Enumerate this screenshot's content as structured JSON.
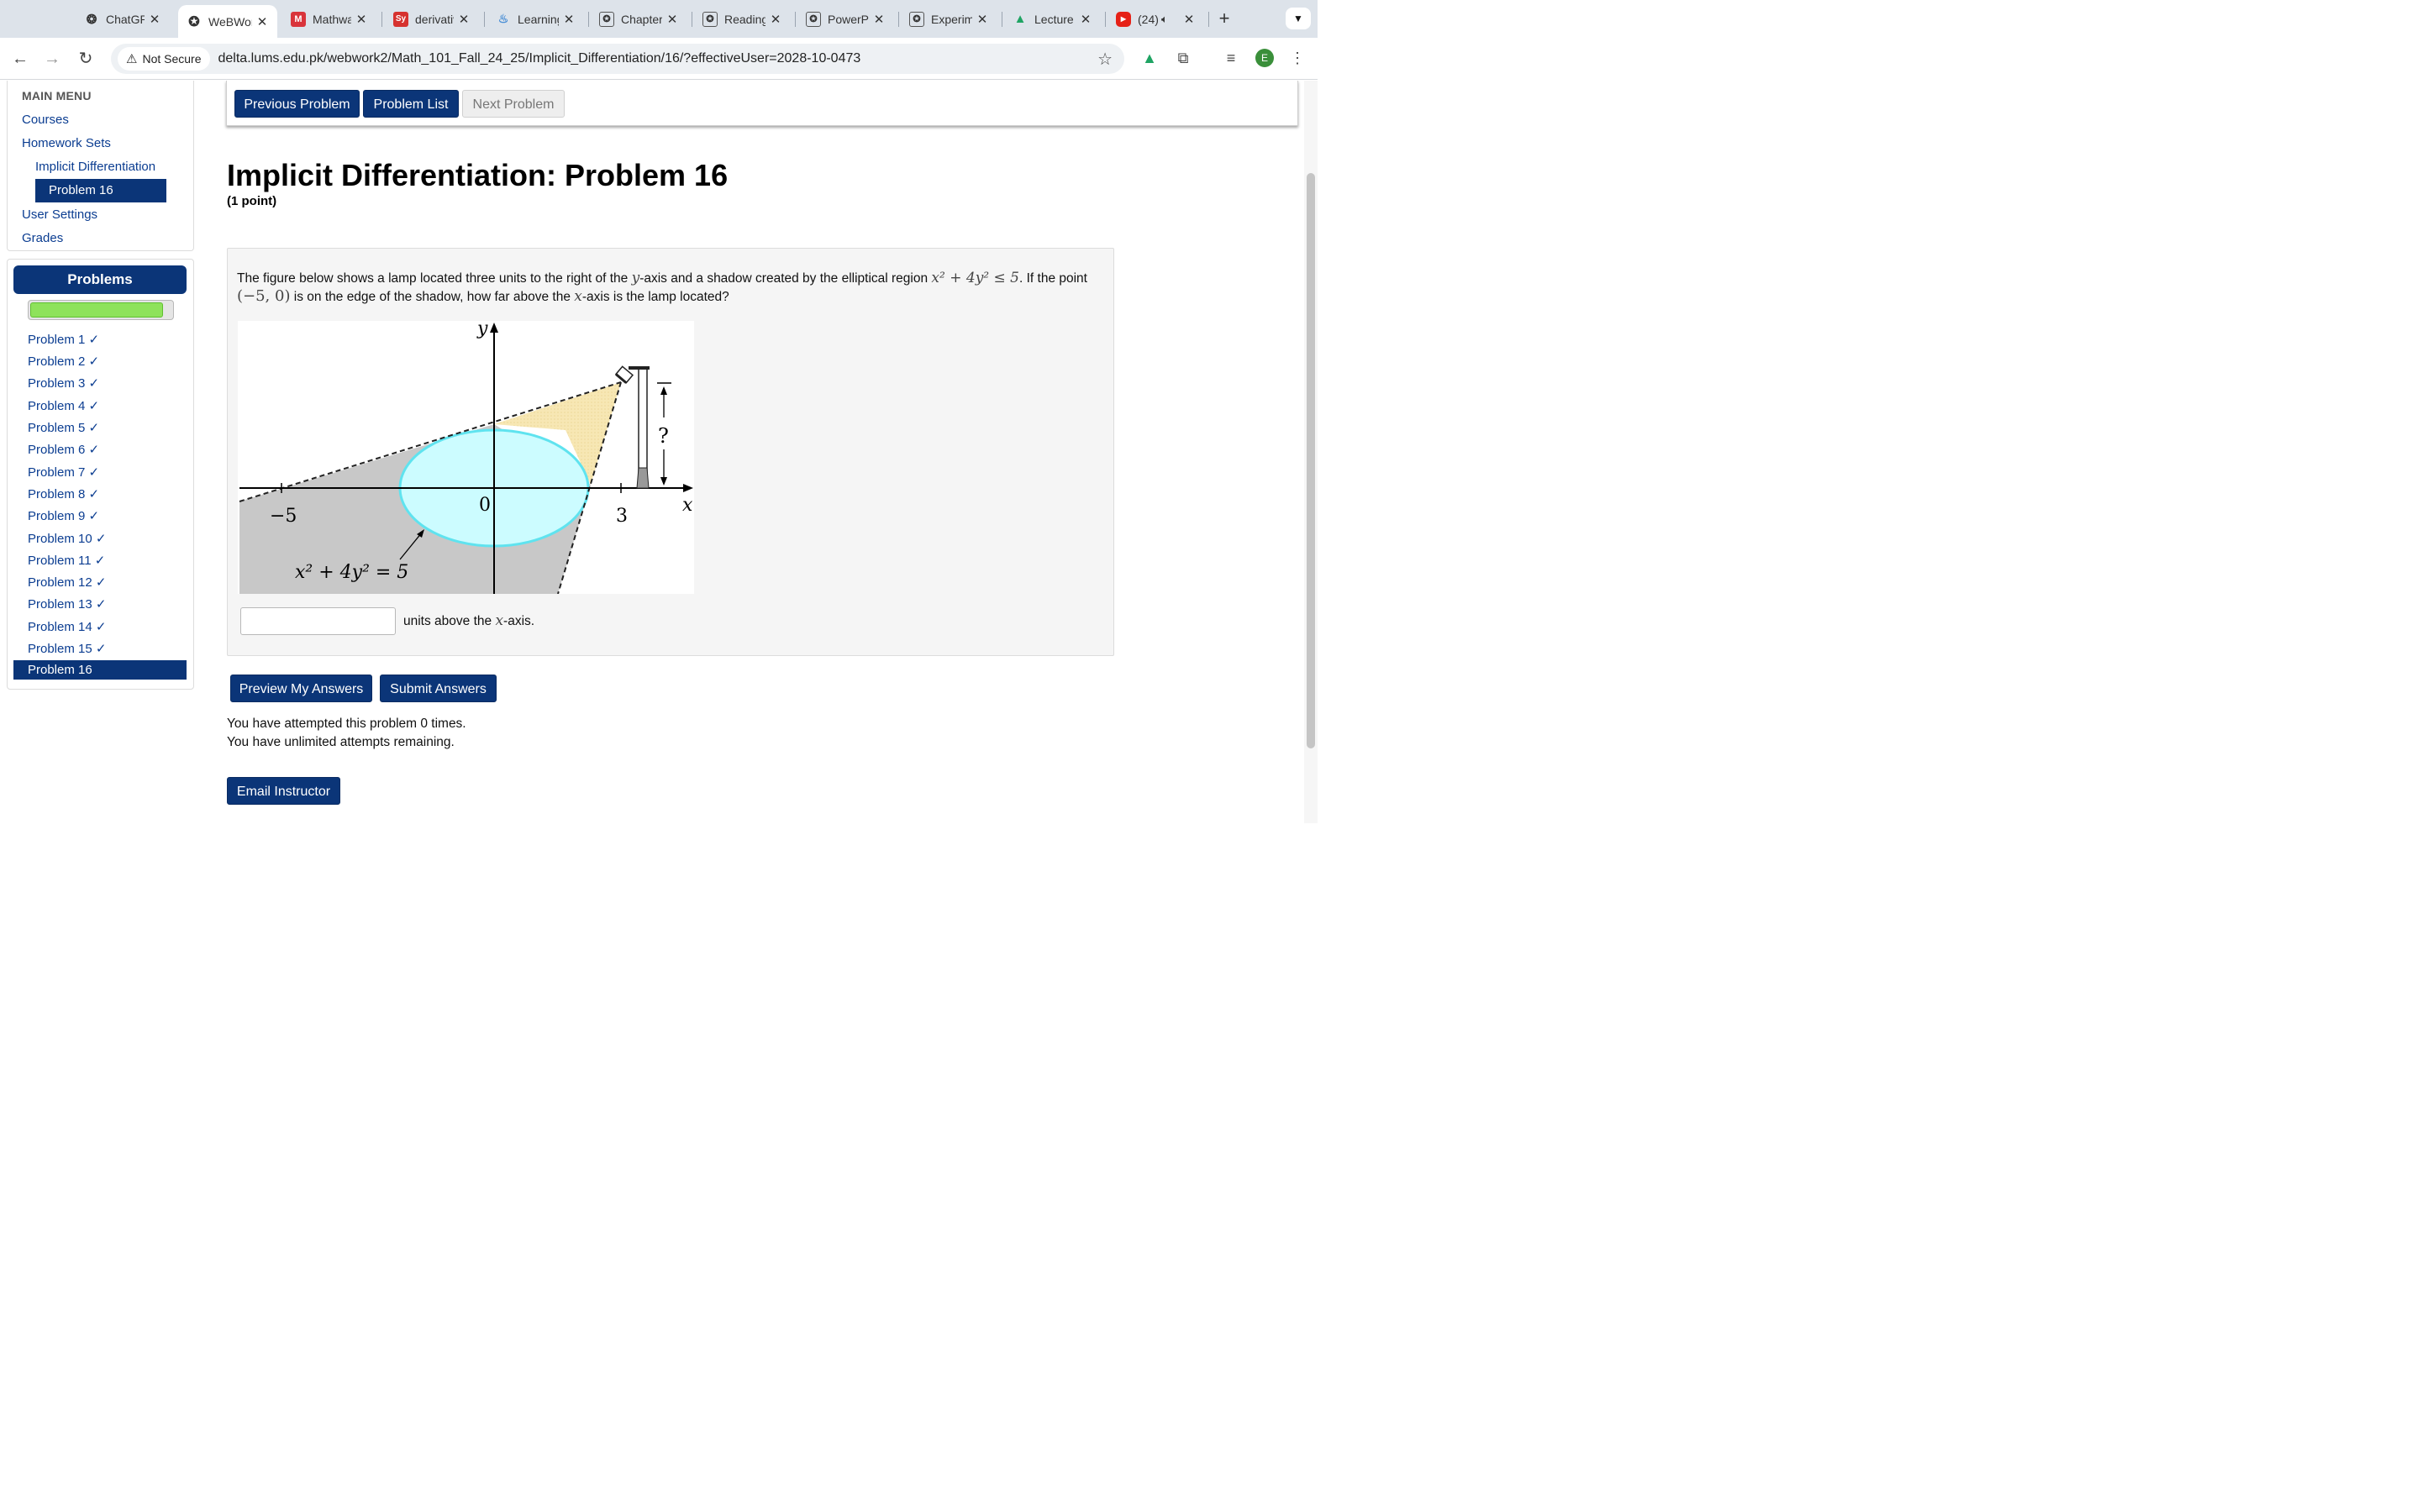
{
  "browser": {
    "tabs": [
      {
        "title": "ChatGPT",
        "favicon": "chatgpt-icon"
      },
      {
        "title": "WeBWorK",
        "favicon": "webwork-icon",
        "active": true
      },
      {
        "title": "Mathway",
        "favicon": "mathway-icon"
      },
      {
        "title": "derivatives",
        "favicon": "symbolab-icon"
      },
      {
        "title": "Learning",
        "favicon": "lms-icon"
      },
      {
        "title": "Chapter",
        "favicon": "webwork-icon"
      },
      {
        "title": "Reading",
        "favicon": "webwork-icon"
      },
      {
        "title": "PowerPoint",
        "favicon": "webwork-icon"
      },
      {
        "title": "Experiment",
        "favicon": "webwork-icon"
      },
      {
        "title": "Lecture",
        "favicon": "drive-icon"
      },
      {
        "title": "(24)",
        "favicon": "youtube-icon"
      }
    ],
    "security_label": "Not Secure",
    "url": "delta.lums.edu.pk/webwork2/Math_101_Fall_24_25/Implicit_Differentiation/16/?effectiveUser=2028-10-0473",
    "avatar_letter": "E"
  },
  "sidebar": {
    "menu_heading": "MAIN MENU",
    "courses": "Courses",
    "homework_sets": "Homework Sets",
    "current_set": "Implicit Differentiation",
    "current_problem": "Problem 16",
    "user_settings": "User Settings",
    "grades": "Grades"
  },
  "problems_panel": {
    "heading": "Problems",
    "progress_fraction": 0.94,
    "items": [
      "Problem 1 ✓",
      "Problem 2 ✓",
      "Problem 3 ✓",
      "Problem 4 ✓",
      "Problem 5 ✓",
      "Problem 6 ✓",
      "Problem 7 ✓",
      "Problem 8 ✓",
      "Problem 9 ✓",
      "Problem 10 ✓",
      "Problem 11 ✓",
      "Problem 12 ✓",
      "Problem 13 ✓",
      "Problem 14 ✓",
      "Problem 15 ✓"
    ],
    "active_item": "Problem 16"
  },
  "nav": {
    "previous": "Previous Problem",
    "list": "Problem List",
    "next": "Next Problem"
  },
  "problem": {
    "title": "Implicit Differentiation: Problem 16",
    "points": "(1 point)",
    "text_1a": "The figure below shows a lamp located three units to the right of the ",
    "text_1b": "-axis and a shadow created by the elliptical region ",
    "text_1c": ". If the point",
    "text_2a": " is on the edge of the shadow, how far above the ",
    "text_2b": "-axis is the lamp located?",
    "var_y": "y",
    "var_x": "x",
    "inequality": "x² + 4y² ≤ 5",
    "point": "(−5, 0)",
    "answer_value": "",
    "answer_suffix_a": "units above the ",
    "answer_suffix_b": "-axis.",
    "figure": {
      "y_label": "y",
      "x_label": "x",
      "tick_neg5": "−5",
      "tick_0": "0",
      "tick_3": "3",
      "question_mark": "?",
      "ellipse_label": "x² + 4y² = 5"
    }
  },
  "actions": {
    "preview": "Preview My Answers",
    "submit": "Submit Answers",
    "email": "Email Instructor"
  },
  "status": {
    "attempted": "You have attempted this problem 0 times.",
    "remaining": "You have unlimited attempts remaining."
  },
  "colors": {
    "primary": "#0b3578",
    "shadow": "#c8c8c8",
    "ellipse_fill": "#ccfcff",
    "ellipse_stroke": "#5fe3ef",
    "light_cone": "#f7e7b4",
    "progress": "#8ee25b"
  }
}
